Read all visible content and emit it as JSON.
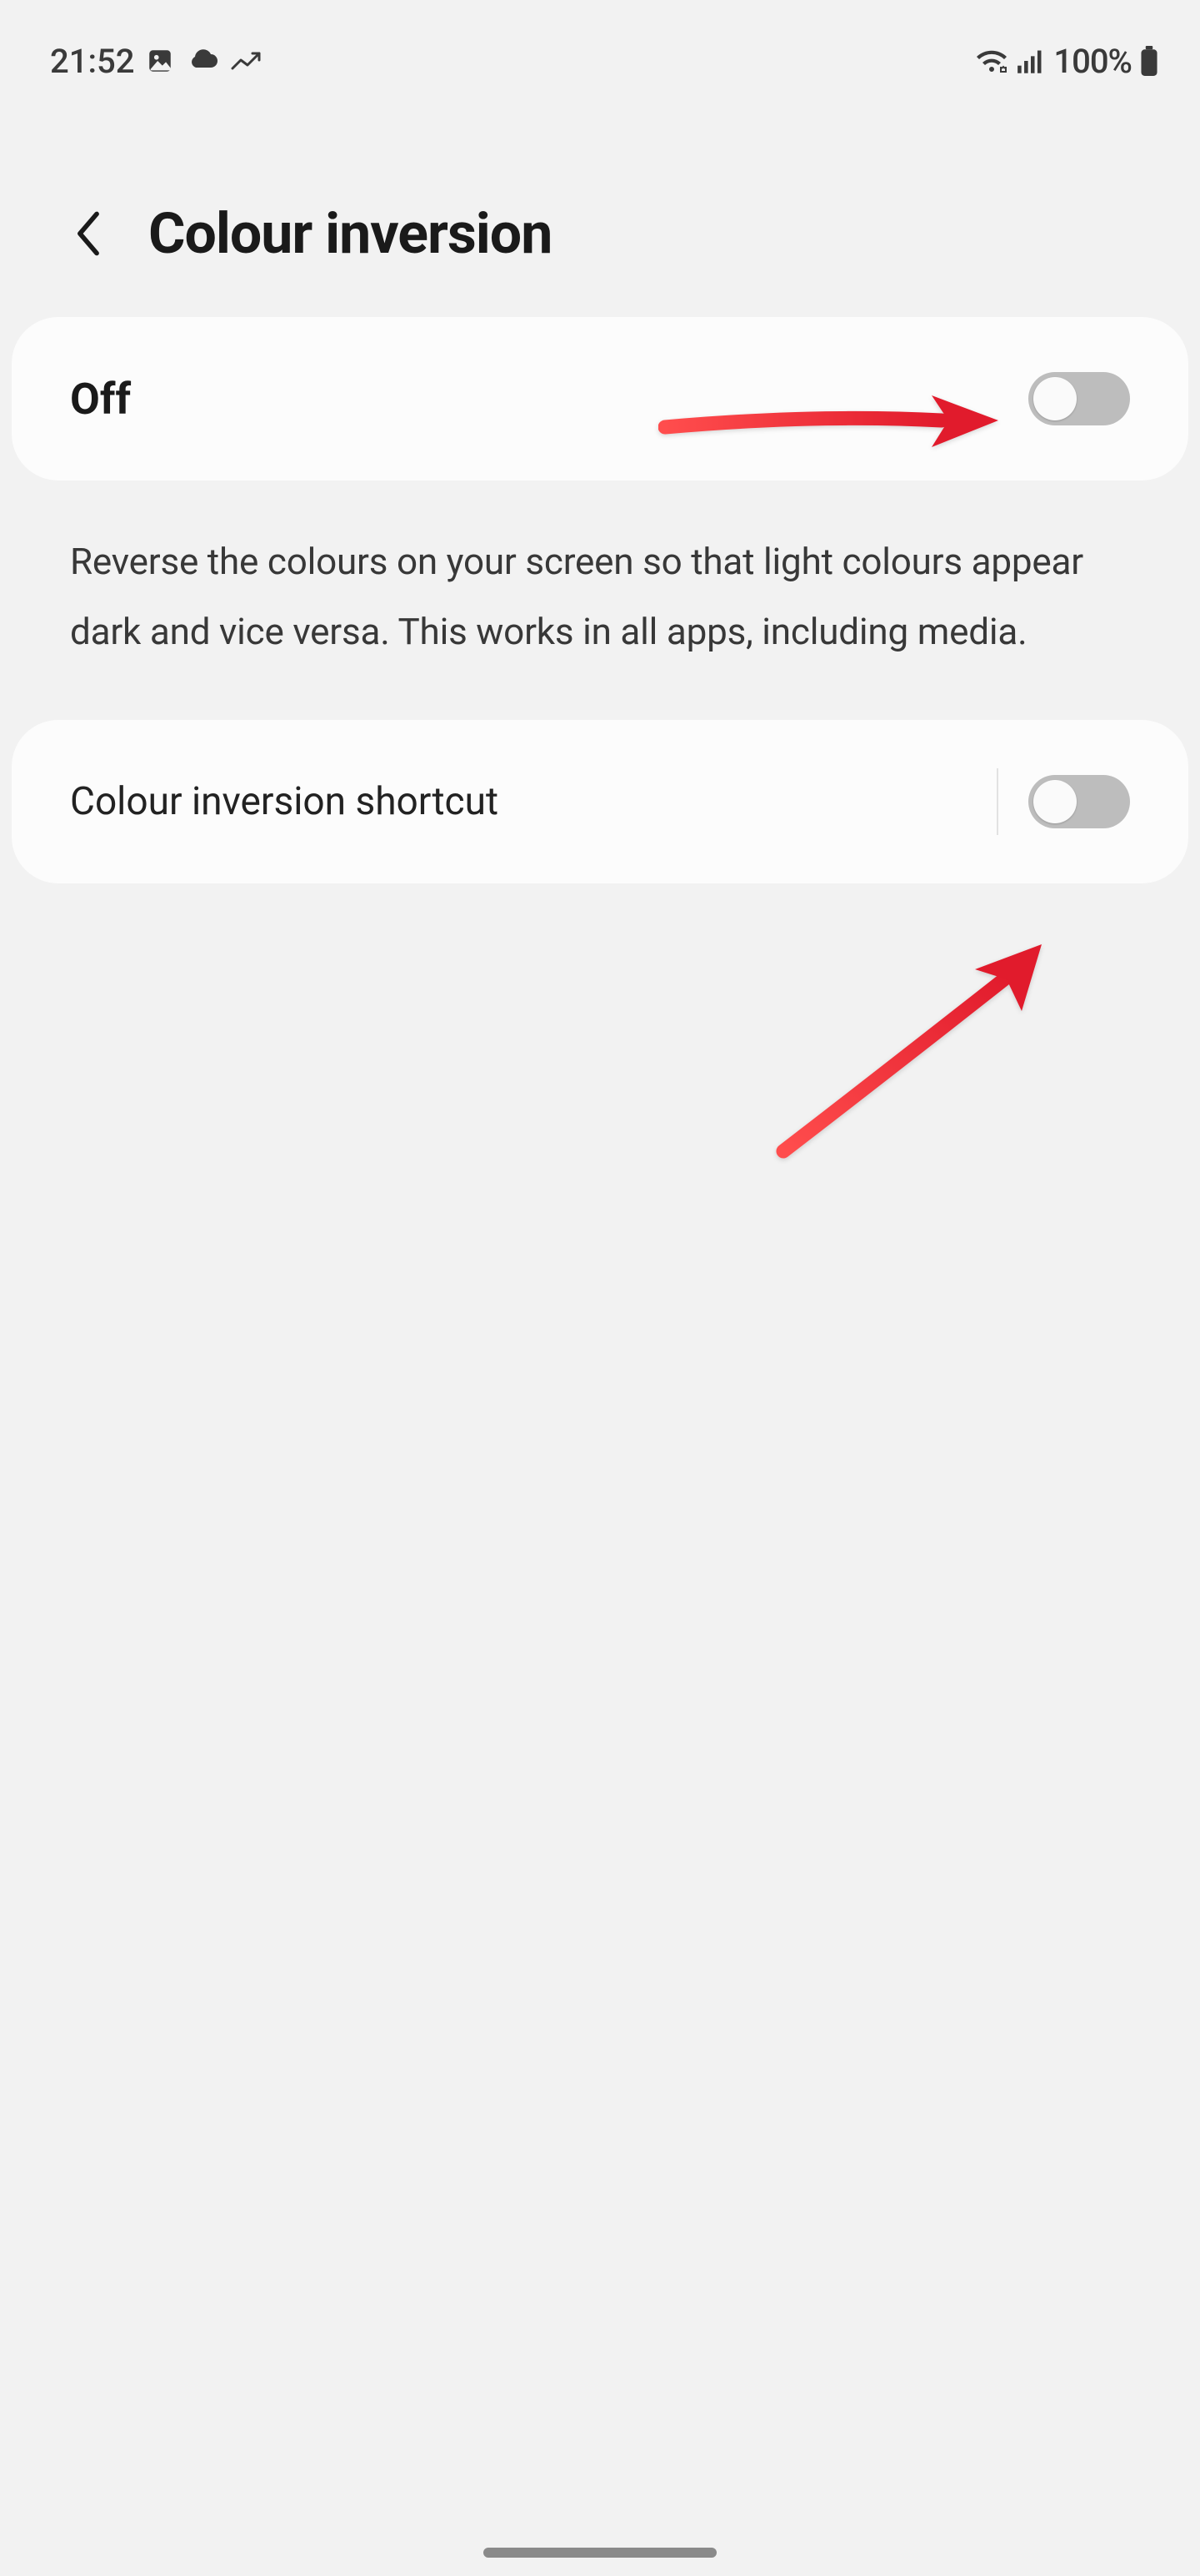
{
  "status": {
    "time": "21:52",
    "battery_text": "100%"
  },
  "header": {
    "title": "Colour inversion"
  },
  "main_toggle": {
    "label": "Off",
    "enabled": false
  },
  "description": "Reverse the colours on your screen so that light colours appear dark and vice versa. This works in all apps, including media.",
  "shortcut": {
    "label": "Colour inversion shortcut",
    "enabled": false
  },
  "annotations": {
    "arrow1_target": "main-toggle-switch",
    "arrow2_target": "shortcut-toggle-switch"
  }
}
